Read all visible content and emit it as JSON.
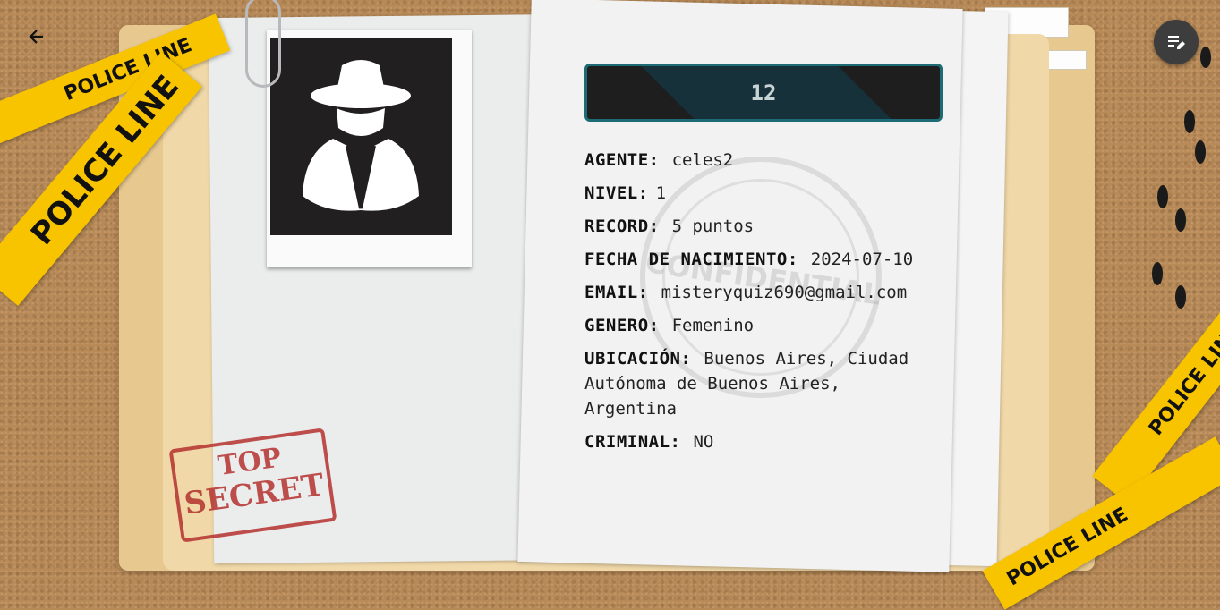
{
  "agent_card": {
    "id": "12",
    "photo_icon": "spy-detective-icon",
    "fields": [
      {
        "key": "AGENTE:",
        "value": "celes2"
      },
      {
        "key": "NIVEL:",
        "value": "1"
      },
      {
        "key": "RECORD:",
        "value": "5 puntos"
      },
      {
        "key": "FECHA DE NACIMIENTO:",
        "value": "2024-07-10"
      },
      {
        "key": "EMAIL:",
        "value": "misteryquiz690@gmail.com"
      },
      {
        "key": "GENERO:",
        "value": "Femenino"
      },
      {
        "key": "UBICACIÓN:",
        "value": "Buenos Aires, Ciudad Autónoma de Buenos Aires, Argentina"
      },
      {
        "key": "CRIMINAL:",
        "value": "NO"
      }
    ]
  },
  "decorations": {
    "tape_text": "POLICE LINE",
    "stamp_top_secret_line1": "TOP",
    "stamp_top_secret_line2": "SECRET",
    "stamp_confidential": "CONFIDENTIAL"
  },
  "controls": {
    "back_icon": "arrow-left-icon",
    "edit_icon": "edit-list-icon"
  },
  "colors": {
    "tape": "#f8c400",
    "banner_border": "#1d6b74",
    "banner_bg": "#1e1e1e",
    "stamp_red": "#b5322e"
  }
}
